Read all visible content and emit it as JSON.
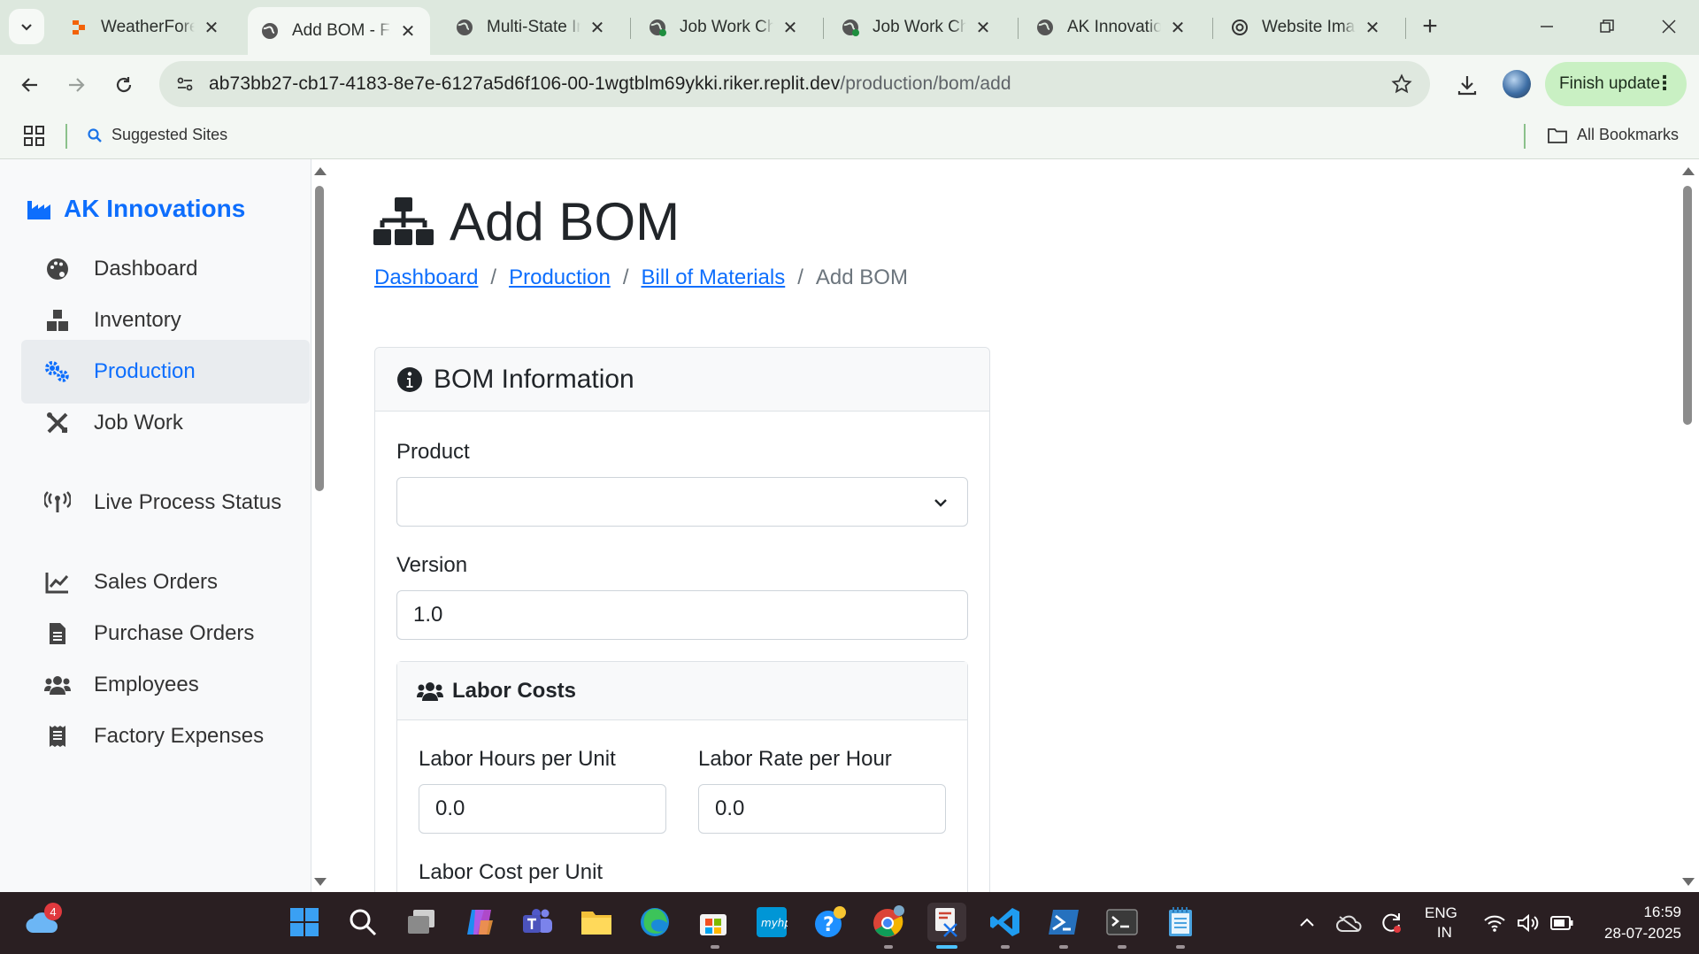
{
  "browser": {
    "tabs": [
      {
        "title": "WeatherForecast",
        "icon": "replit-icon"
      },
      {
        "title": "Add BOM - Factory",
        "icon": "globe-icon",
        "active": true
      },
      {
        "title": "Multi-State Inventory",
        "icon": "globe-icon"
      },
      {
        "title": "Job Work Challan",
        "icon": "globe-icon"
      },
      {
        "title": "Job Work Challan",
        "icon": "globe-icon"
      },
      {
        "title": "AK Innovations",
        "icon": "globe-icon"
      },
      {
        "title": "Website Image",
        "icon": "openai-icon"
      }
    ],
    "url_host": "ab73bb27-cb17-4183-8e7e-6127a5d6f106-00-1wgtblm69ykki.riker.replit.dev",
    "url_path": "/production/bom/add",
    "finish_update": "Finish update",
    "bookmarks": {
      "suggested": "Suggested Sites",
      "all": "All Bookmarks"
    }
  },
  "sidebar": {
    "brand": "AK Innovations",
    "items": [
      {
        "label": "Dashboard",
        "icon": "palette-icon"
      },
      {
        "label": "Inventory",
        "icon": "boxes-icon"
      },
      {
        "label": "Production",
        "icon": "gears-icon",
        "active": true
      },
      {
        "label": "Job Work",
        "icon": "tools-icon"
      },
      {
        "label": "Live Process Status",
        "icon": "broadcast-icon"
      },
      {
        "label": "Sales Orders",
        "icon": "chart-line-icon"
      },
      {
        "label": "Purchase Orders",
        "icon": "file-icon"
      },
      {
        "label": "Employees",
        "icon": "users-icon"
      },
      {
        "label": "Factory Expenses",
        "icon": "receipt-icon"
      }
    ]
  },
  "page": {
    "title": "Add BOM",
    "breadcrumb": [
      "Dashboard",
      "Production",
      "Bill of Materials",
      "Add BOM"
    ],
    "card_title": "BOM Information",
    "product_label": "Product",
    "product_value": "",
    "version_label": "Version",
    "version_value": "1.0",
    "labor": {
      "title": "Labor Costs",
      "hours_label": "Labor Hours per Unit",
      "hours_value": "0.0",
      "rate_label": "Labor Rate per Hour",
      "rate_value": "0.0",
      "cost_label": "Labor Cost per Unit"
    }
  },
  "taskbar": {
    "weather_badge": "4",
    "lang": "ENG",
    "region": "IN",
    "time": "16:59",
    "date": "28-07-2025"
  },
  "colors": {
    "accent": "#0d6efd",
    "tabstrip": "#dde8de",
    "taskbar": "#2a1f22"
  }
}
